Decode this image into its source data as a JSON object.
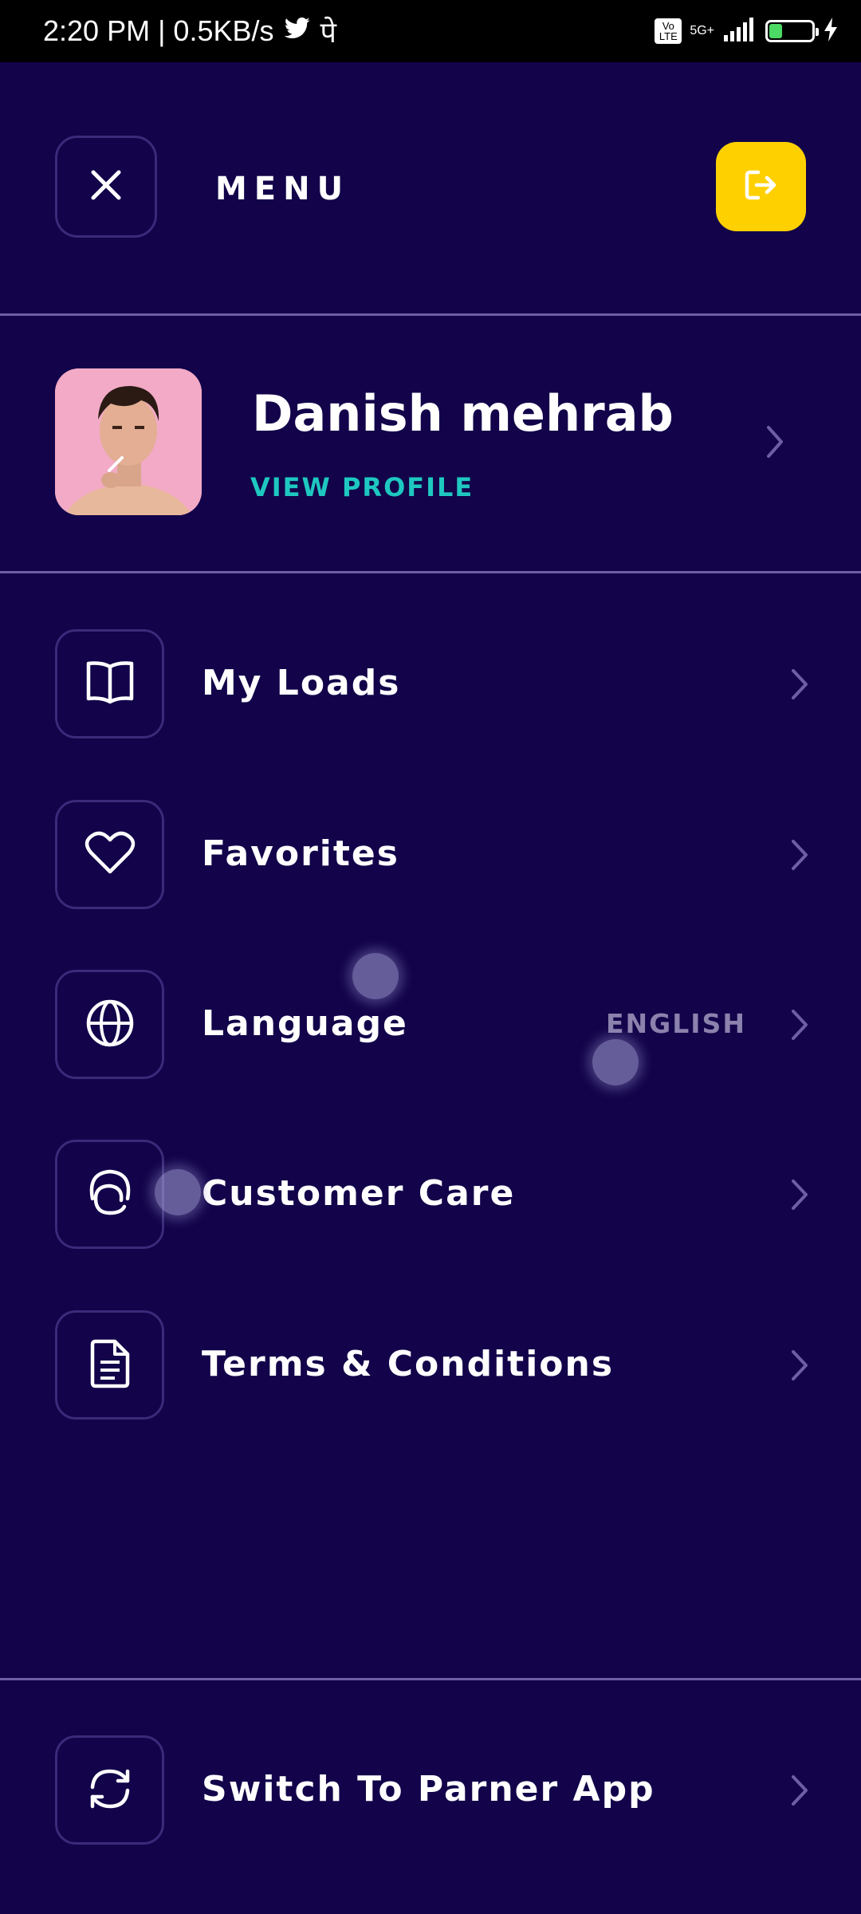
{
  "status_bar": {
    "time_speed": "2:20 PM | 0.5KB/s",
    "hindi_glyph": "पे",
    "network": "5G+",
    "volte": "Vo LTE",
    "battery": "31",
    "battery_level": 0.31
  },
  "header": {
    "title": "MENU",
    "close_icon": "close-icon",
    "logout_icon": "logout-icon",
    "accent_color": "#ffd000"
  },
  "profile": {
    "name": "Danish mehrab",
    "link": "VIEW PROFILE",
    "link_color": "#1ec8c0"
  },
  "menu": {
    "items": [
      {
        "label": "My Loads",
        "icon": "book-icon"
      },
      {
        "label": "Favorites",
        "icon": "heart-icon"
      },
      {
        "label": "Language",
        "icon": "globe-icon",
        "value": "ENGLISH"
      },
      {
        "label": "Customer Care",
        "icon": "headset-icon"
      },
      {
        "label": "Terms & Conditions",
        "icon": "document-icon"
      }
    ]
  },
  "footer": {
    "switch_label": "Switch To Parner App",
    "icon": "refresh-icon"
  },
  "theme": {
    "background": "#12034a",
    "divider": "#6c5fa6"
  }
}
